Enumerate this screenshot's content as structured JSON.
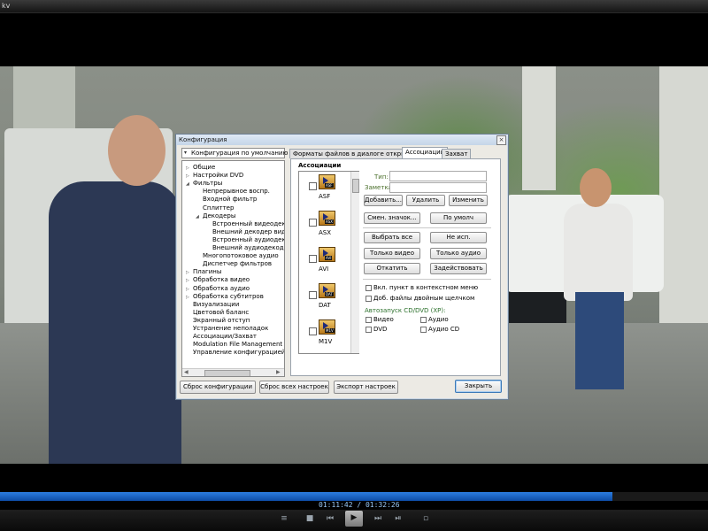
{
  "window": {
    "title": "kv"
  },
  "dialog": {
    "title": "Конфигурация",
    "close_label": "×",
    "profile_select": "Конфигурация по умолчанию",
    "tree": [
      {
        "label": "Общие",
        "expander": "▷"
      },
      {
        "label": "Настройки DVD",
        "expander": "▷"
      },
      {
        "label": "Фильтры",
        "expander": "◢"
      },
      {
        "label": "Непрерывное воспр.",
        "expander": ""
      },
      {
        "label": "Входной фильтр",
        "expander": ""
      },
      {
        "label": "Сплиттер",
        "expander": ""
      },
      {
        "label": "Декодеры",
        "expander": "◢"
      },
      {
        "label": "Встроенный видеодекодер",
        "expander": ""
      },
      {
        "label": "Внешний декодер видео",
        "expander": ""
      },
      {
        "label": "Встроенный аудиодекодер",
        "expander": ""
      },
      {
        "label": "Внешний аудиодекодер",
        "expander": ""
      },
      {
        "label": "Многопотоковое аудио",
        "expander": ""
      },
      {
        "label": "Диспетчер фильтров",
        "expander": ""
      },
      {
        "label": "Плагины",
        "expander": "▷"
      },
      {
        "label": "Обработка видео",
        "expander": "▷"
      },
      {
        "label": "Обработка аудио",
        "expander": "▷"
      },
      {
        "label": "Обработка субтитров",
        "expander": "▷"
      },
      {
        "label": "Визуализации",
        "expander": ""
      },
      {
        "label": "Цветовой баланс",
        "expander": ""
      },
      {
        "label": "Экранный отступ",
        "expander": ""
      },
      {
        "label": "Устранение неполадок",
        "expander": ""
      },
      {
        "label": "Ассоциации/Захват",
        "expander": ""
      },
      {
        "label": "Modulation File Management",
        "expander": ""
      },
      {
        "label": "Управление конфигурацией",
        "expander": ""
      }
    ],
    "tabs": [
      {
        "label": "Форматы файлов в диалоге открытия",
        "active": false
      },
      {
        "label": "Ассоциации",
        "active": true
      },
      {
        "label": "Захват",
        "active": false
      }
    ],
    "associations": {
      "label": "Ассоциации",
      "items": [
        "ASF",
        "ASX",
        "AVI",
        "DAT",
        "M1V"
      ],
      "icon_tags": [
        "ASF",
        "ASX",
        "AVI",
        "DAT",
        "M1V"
      ]
    },
    "type_label": "Тип:",
    "note_label": "Заметка:",
    "buttons": {
      "add": "Добавить...",
      "delete": "Удалить",
      "edit": "Изменить",
      "change_icon": "Смен. значок...",
      "default": "По умолч",
      "select_all": "Выбрать все",
      "none": "Не исп.",
      "video_only": "Только видео",
      "audio_only": "Только аудио",
      "rollback": "Откатить",
      "apply": "Задействовать"
    },
    "checkboxes": {
      "context_menu": "Вкл. пункт в контекстном меню",
      "double_click": "Доб. файлы двойным щелчком"
    },
    "autorun": {
      "label": "Автозапуск CD/DVD (XP):",
      "video": "Видео",
      "audio": "Аудио",
      "dvd": "DVD",
      "audio_cd": "Аудио CD"
    },
    "bottom_buttons": {
      "reset_config": "Сброс конфигурации",
      "reset_all": "Сброс всех настроек",
      "export": "Экспорт настроек",
      "close": "Закрыть"
    }
  },
  "player": {
    "timecode": "01:11:42 / 01:32:26",
    "progress": 0.865,
    "controls": [
      "playlist-icon",
      "stop-icon",
      "prev-icon",
      "play-icon",
      "next-icon",
      "frame-step-icon",
      "fullscreen-icon"
    ],
    "control_glyphs": [
      "≡",
      "■",
      "⏮",
      "▶",
      "⏭",
      "⏯",
      "▫"
    ]
  },
  "colors": {
    "progress": "#1565d8",
    "dialog_bg": "#eceae4"
  }
}
